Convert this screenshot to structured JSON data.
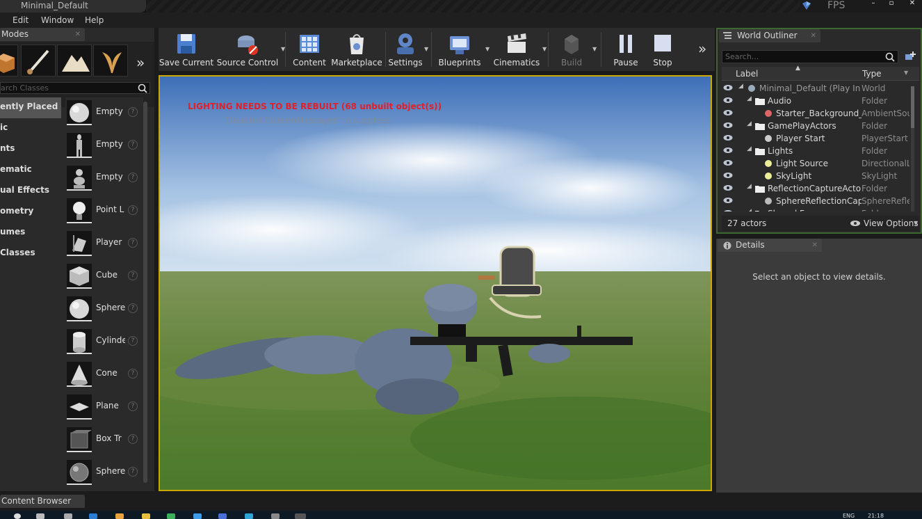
{
  "window": {
    "title": "Minimal_Default",
    "fps_label": "FPS",
    "controls": [
      "–",
      "▫",
      "✕"
    ]
  },
  "menu": [
    "Edit",
    "Window",
    "Help"
  ],
  "modes_panel": {
    "tab_label": "Modes",
    "search_placeholder": "arch Classes",
    "categories": [
      {
        "label": "ently Placed",
        "selected": true
      },
      {
        "label": "ic",
        "selected": false
      },
      {
        "label": "nts",
        "selected": false
      },
      {
        "label": "ematic",
        "selected": false
      },
      {
        "label": "ual Effects",
        "selected": false
      },
      {
        "label": "ometry",
        "selected": false
      },
      {
        "label": "umes",
        "selected": false
      },
      {
        "label": "Classes",
        "selected": false
      }
    ],
    "place_items": [
      {
        "label": "Empty",
        "icon": "sphere-icon"
      },
      {
        "label": "Empty",
        "icon": "character-icon"
      },
      {
        "label": "Empty",
        "icon": "pawn-icon"
      },
      {
        "label": "Point L",
        "icon": "point-light-icon"
      },
      {
        "label": "Player",
        "icon": "player-start-icon"
      },
      {
        "label": "Cube",
        "icon": "cube-icon"
      },
      {
        "label": "Sphere",
        "icon": "sphere-icon"
      },
      {
        "label": "Cylinde",
        "icon": "cylinder-icon"
      },
      {
        "label": "Cone",
        "icon": "cone-icon"
      },
      {
        "label": "Plane",
        "icon": "plane-icon"
      },
      {
        "label": "Box Tr",
        "icon": "box-trigger-icon"
      },
      {
        "label": "Sphere",
        "icon": "sphere-trigger-icon"
      }
    ],
    "help_glyph": "?"
  },
  "toolbar": {
    "buttons": [
      {
        "label": "Save Current",
        "icon": "save-icon",
        "caret": false,
        "disabled": false
      },
      {
        "label": "Source Control",
        "icon": "source-control-icon",
        "caret": true,
        "disabled": false
      },
      {
        "label": "Content",
        "icon": "content-icon",
        "caret": false,
        "disabled": false
      },
      {
        "label": "Marketplace",
        "icon": "marketplace-icon",
        "caret": false,
        "disabled": false
      },
      {
        "label": "Settings",
        "icon": "settings-icon",
        "caret": true,
        "disabled": false
      },
      {
        "label": "Blueprints",
        "icon": "blueprints-icon",
        "caret": true,
        "disabled": false
      },
      {
        "label": "Cinematics",
        "icon": "cinematics-icon",
        "caret": true,
        "disabled": false
      },
      {
        "label": "Build",
        "icon": "build-icon",
        "caret": true,
        "disabled": true
      },
      {
        "label": "Pause",
        "icon": "pause-icon",
        "caret": false,
        "disabled": false
      },
      {
        "label": "Stop",
        "icon": "stop-icon",
        "caret": false,
        "disabled": false
      }
    ],
    "overflow_glyph": "»"
  },
  "viewport": {
    "warning": "LIGHTING NEEDS TO BE REBUILT (68 unbuilt object(s))",
    "hint": "'DisableAllScreenMessages' to suppress"
  },
  "outliner": {
    "tab_label": "World Outliner",
    "search_placeholder": "Search...",
    "col_label": "Label",
    "col_type": "Type",
    "rows": [
      {
        "label": "Minimal_Default (Play In Editor)",
        "type": "World",
        "indent": 0,
        "expander": true,
        "dim": true
      },
      {
        "label": "Audio",
        "type": "Folder",
        "indent": 1,
        "expander": true,
        "dim": false
      },
      {
        "label": "Starter_Background_Cue",
        "type": "AmbientSound",
        "indent": 2,
        "expander": false,
        "dim": false
      },
      {
        "label": "GamePlayActors",
        "type": "Folder",
        "indent": 1,
        "expander": true,
        "dim": false
      },
      {
        "label": "Player Start",
        "type": "PlayerStart",
        "indent": 2,
        "expander": false,
        "dim": false
      },
      {
        "label": "Lights",
        "type": "Folder",
        "indent": 1,
        "expander": true,
        "dim": false
      },
      {
        "label": "Light Source",
        "type": "DirectionalLight",
        "indent": 2,
        "expander": false,
        "dim": false
      },
      {
        "label": "SkyLight",
        "type": "SkyLight",
        "indent": 2,
        "expander": false,
        "dim": false
      },
      {
        "label": "ReflectionCaptureActors",
        "type": "Folder",
        "indent": 1,
        "expander": true,
        "dim": false
      },
      {
        "label": "SphereReflectionCapture",
        "type": "SphereReflectionCapture",
        "indent": 2,
        "expander": false,
        "dim": false
      },
      {
        "label": "Shared Frames",
        "type": "Folder",
        "indent": 1,
        "expander": true,
        "dim": false
      }
    ],
    "actor_count": "27 actors",
    "view_options": "View Options"
  },
  "details": {
    "tab_label": "Details",
    "message": "Select an object to view details."
  },
  "content_browser": {
    "tab_label": "Content Browser"
  },
  "taskbar": {
    "lang": "ENG",
    "time": "21:18"
  },
  "colors": {
    "viewport_border": "#c9a800",
    "warning": "#e0202a",
    "outliner_focus": "#3c6a2e"
  }
}
